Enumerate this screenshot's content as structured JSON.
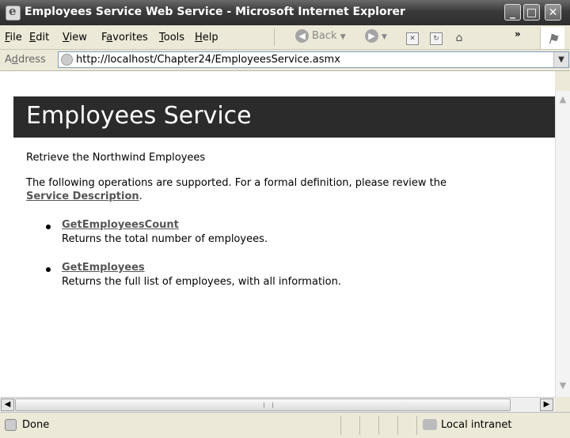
{
  "window": {
    "title": "Employees Service Web Service - Microsoft Internet Explorer",
    "min_glyph": "_",
    "max_glyph": "□",
    "close_glyph": "✕"
  },
  "menu": {
    "items": [
      {
        "pre": "",
        "key": "F",
        "post": "ile"
      },
      {
        "pre": "",
        "key": "E",
        "post": "dit"
      },
      {
        "pre": "",
        "key": "V",
        "post": "iew"
      },
      {
        "pre": "F",
        "key": "a",
        "post": "vorites"
      },
      {
        "pre": "",
        "key": "T",
        "post": "ools"
      },
      {
        "pre": "",
        "key": "H",
        "post": "elp"
      }
    ],
    "back_label": "Back",
    "overflow": "»"
  },
  "address": {
    "label_pre": "A",
    "label_key": "d",
    "label_post": "dress",
    "url": "http://localhost/Chapter24/EmployeesService.asmx"
  },
  "page": {
    "heading": "Employees Service",
    "description": "Retrieve the Northwind Employees",
    "intro": "The following operations are supported. For a formal definition, please review the",
    "service_link": "Service Description",
    "operations": [
      {
        "name": "GetEmployeesCount",
        "desc": "Returns the total number of employees."
      },
      {
        "name": "GetEmployees",
        "desc": "Returns the full list of employees, with all information."
      }
    ]
  },
  "status": {
    "text": "Done",
    "zone": "Local intranet"
  },
  "icons": {
    "browser": "ie-icon",
    "page": "page-icon",
    "zone": "intranet-icon"
  }
}
